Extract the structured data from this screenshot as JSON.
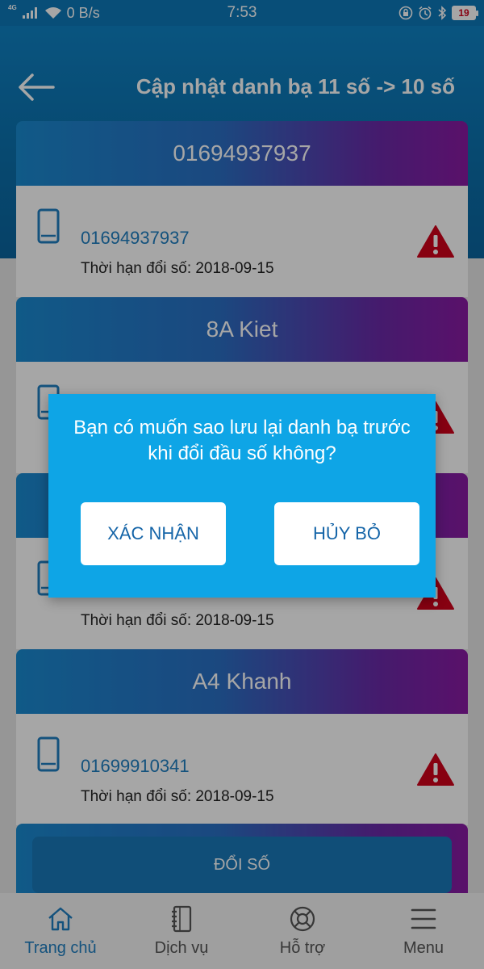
{
  "status_bar": {
    "network": "4G",
    "speed": "0 B/s",
    "time": "7:53",
    "battery": "19"
  },
  "header": {
    "title": "Cập nhật danh bạ 11 số -> 10 số"
  },
  "contacts": [
    {
      "name": "01694937937",
      "number": "01694937937",
      "term": "Thời hạn đổi số: 2018-09-15"
    },
    {
      "name": "8A Kiet",
      "number": "",
      "term": ""
    },
    {
      "name": "",
      "number": "",
      "term": "Thời hạn đổi số: 2018-09-15"
    },
    {
      "name": "A4 Khanh",
      "number": "01699910341",
      "term": "Thời hạn đổi số: 2018-09-15"
    }
  ],
  "actions": {
    "doi_so_label": "ĐỔI SỐ"
  },
  "dialog": {
    "message": "Bạn có muốn sao lưu lại danh bạ trước khi đổi đầu số không?",
    "confirm_label": "XÁC NHẬN",
    "cancel_label": "HỦY BỎ"
  },
  "bottom_nav": {
    "items": [
      {
        "label": "Trang chủ",
        "icon": "home-icon"
      },
      {
        "label": "Dịch vụ",
        "icon": "notebook-icon"
      },
      {
        "label": "Hỗ trợ",
        "icon": "lifebuoy-icon"
      },
      {
        "label": "Menu",
        "icon": "menu-icon"
      }
    ]
  },
  "colors": {
    "accent": "#1f7ec0",
    "dialog": "#0ea5e6",
    "warning": "#d0021b"
  }
}
